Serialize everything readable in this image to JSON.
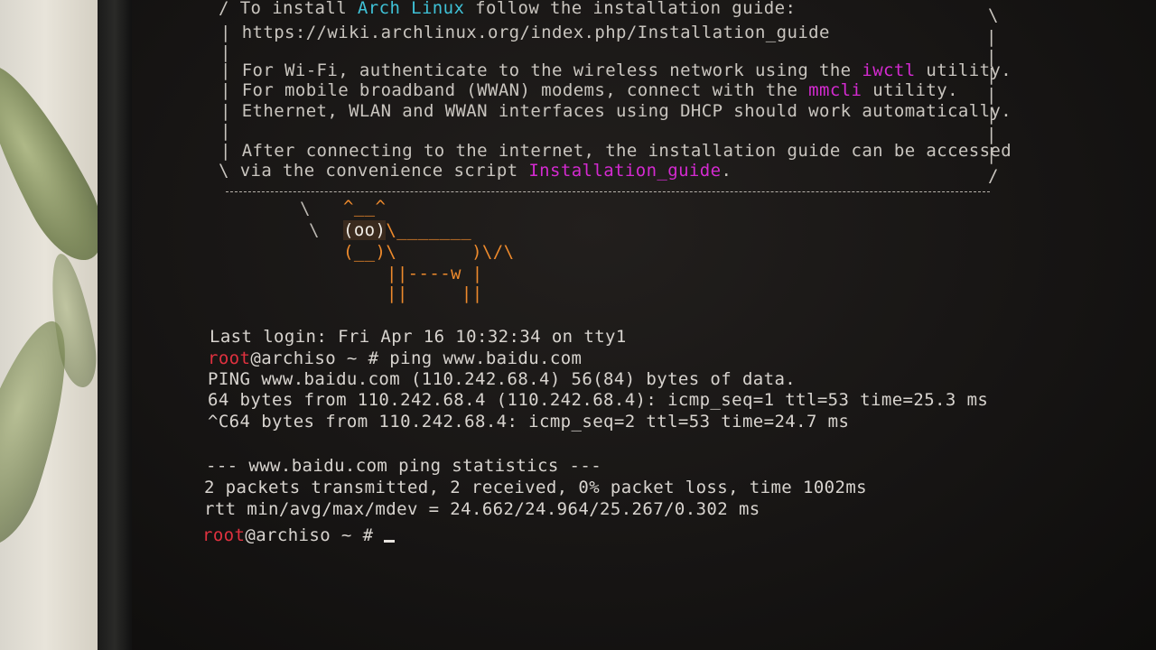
{
  "motd": {
    "l1": {
      "pre": "To install ",
      "arch": "Arch Linux",
      "post": " follow the installation guide:"
    },
    "l2": "https://wiki.archlinux.org/index.php/Installation_guide",
    "l3": {
      "pre": "For Wi-Fi, authenticate to the wireless network using the ",
      "cmd": "iwctl",
      "post": " utility."
    },
    "l4": {
      "pre": "For mobile broadband (WWAN) modems, connect with the ",
      "cmd": "mmcli",
      "post": " utility."
    },
    "l5": "Ethernet, WLAN and WWAN interfaces using DHCP should work automatically.",
    "l6": "After connecting to the internet, the installation guide can be accessed",
    "l7": {
      "pre": "via the convenience script ",
      "cmd": "Installation_guide",
      "post": "."
    }
  },
  "cow": {
    "c1": "^__^",
    "c2a": "(oo)",
    "c2b": "\\_______",
    "c3a": "(__)\\",
    "c3b": "       )\\/\\",
    "c4": "||----w |",
    "c5": "||     ||"
  },
  "session": {
    "last_login": "Last login: Fri Apr 16 10:32:34 on tty1",
    "user": "root",
    "host_prompt": "@archiso ~ # ",
    "command": "ping www.baidu.com",
    "ping_header": "PING www.baidu.com (110.242.68.4) 56(84) bytes of data.",
    "reply1": "64 bytes from 110.242.68.4 (110.242.68.4): icmp_seq=1 ttl=53 time=25.3 ms",
    "reply2": "^C64 bytes from 110.242.68.4: icmp_seq=2 ttl=53 time=24.7 ms",
    "stats_header": "--- www.baidu.com ping statistics ---",
    "stats_packets": "2 packets transmitted, 2 received, 0% packet loss, time 1002ms",
    "stats_rtt": "rtt min/avg/max/mdev = 24.662/24.964/25.267/0.302 ms",
    "user2": "root",
    "host_prompt2": "@archiso ~ # "
  },
  "colors": {
    "arch_blue": "#3fc1d6",
    "highlight_magenta": "#d42ad0",
    "root_red": "#e0313f",
    "cow_orange": "#ee8a2c"
  }
}
